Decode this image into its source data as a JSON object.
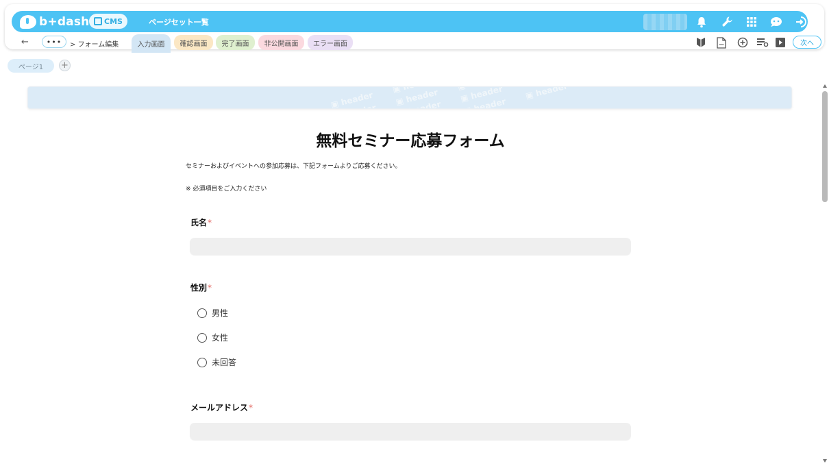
{
  "app": {
    "logo_text": "b+dash",
    "cms_label": "CMS",
    "title": "ページセット一覧"
  },
  "subbar": {
    "more": "•••",
    "breadcrumb": "> フォーム編集",
    "tabs": [
      {
        "label": "入力画面",
        "color": "#d3e6f5",
        "active": true
      },
      {
        "label": "確認画面",
        "color": "#fbe7c4"
      },
      {
        "label": "完了画面",
        "color": "#dff0cf"
      },
      {
        "label": "非公開画面",
        "color": "#fbd9df"
      },
      {
        "label": "エラー画面",
        "color": "#eadff5"
      }
    ],
    "next_label": "次へ"
  },
  "pages": {
    "items": [
      "ページ1"
    ],
    "add_label": "+"
  },
  "header_block": {
    "pattern_text": "header"
  },
  "form": {
    "title": "無料セミナー応募フォーム",
    "lead": "セミナーおよびイベントへの参加応募は、下記フォームよりご応募ください。",
    "note": "※ 必須項目をご入力ください",
    "required_mark": "*",
    "fields": {
      "name": {
        "label": "氏名",
        "value": ""
      },
      "gender": {
        "label": "性別",
        "options": [
          "男性",
          "女性",
          "未回答"
        ]
      },
      "email": {
        "label": "メールアドレス",
        "value": ""
      }
    }
  },
  "colors": {
    "brand": "#4dc3f4",
    "required": "#e26a64"
  }
}
